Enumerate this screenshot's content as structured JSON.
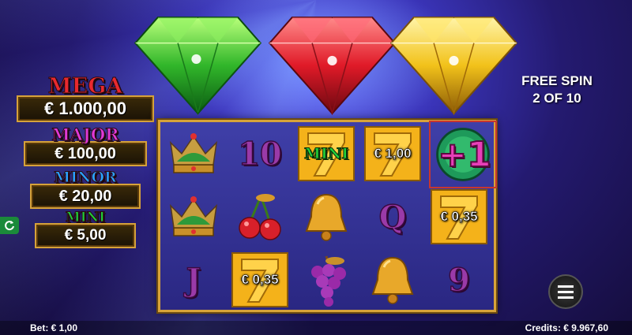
{
  "jackpots": {
    "mega": {
      "label": "MEGA",
      "value": "€ 1.000,00",
      "color": "#e8292e"
    },
    "major": {
      "label": "MAJOR",
      "value": "€ 100,00",
      "color": "#e03ad8"
    },
    "minor": {
      "label": "MINOR",
      "value": "€ 20,00",
      "color": "#2aa0ff"
    },
    "mini": {
      "label": "MINI",
      "value": "€ 5,00",
      "color": "#1fce3a"
    }
  },
  "free_spin": {
    "line1": "FREE SPIN",
    "line2": "2 OF 10"
  },
  "gems": [
    {
      "name": "green-diamond-icon",
      "color": "#2fb82a"
    },
    {
      "name": "red-diamond-icon",
      "color": "#e0202a"
    },
    {
      "name": "yellow-diamond-icon",
      "color": "#f2c21a"
    }
  ],
  "reels": {
    "row1": [
      "crown-icon",
      "10",
      "seven-mini",
      "seven-prize",
      "plus-one"
    ],
    "row2": [
      "crown-icon",
      "cherries-icon",
      "bell-icon",
      "Q",
      "seven-prize"
    ],
    "row3": [
      "J",
      "seven-prize",
      "grapes-icon",
      "bell-icon",
      "9"
    ],
    "cells": {
      "r1c2": "10",
      "r1c3_tag": "MINI",
      "r1c4_prize": "€ 1,00",
      "r1c5_text": "+1",
      "r2c4": "Q",
      "r2c5_prize": "€ 0,35",
      "r3c1": "J",
      "r3c2_prize": "€ 0,35",
      "r3c5": "9"
    }
  },
  "footer": {
    "bet": "Bet: € 1,00",
    "credits": "Credits: € 9.967,60"
  }
}
